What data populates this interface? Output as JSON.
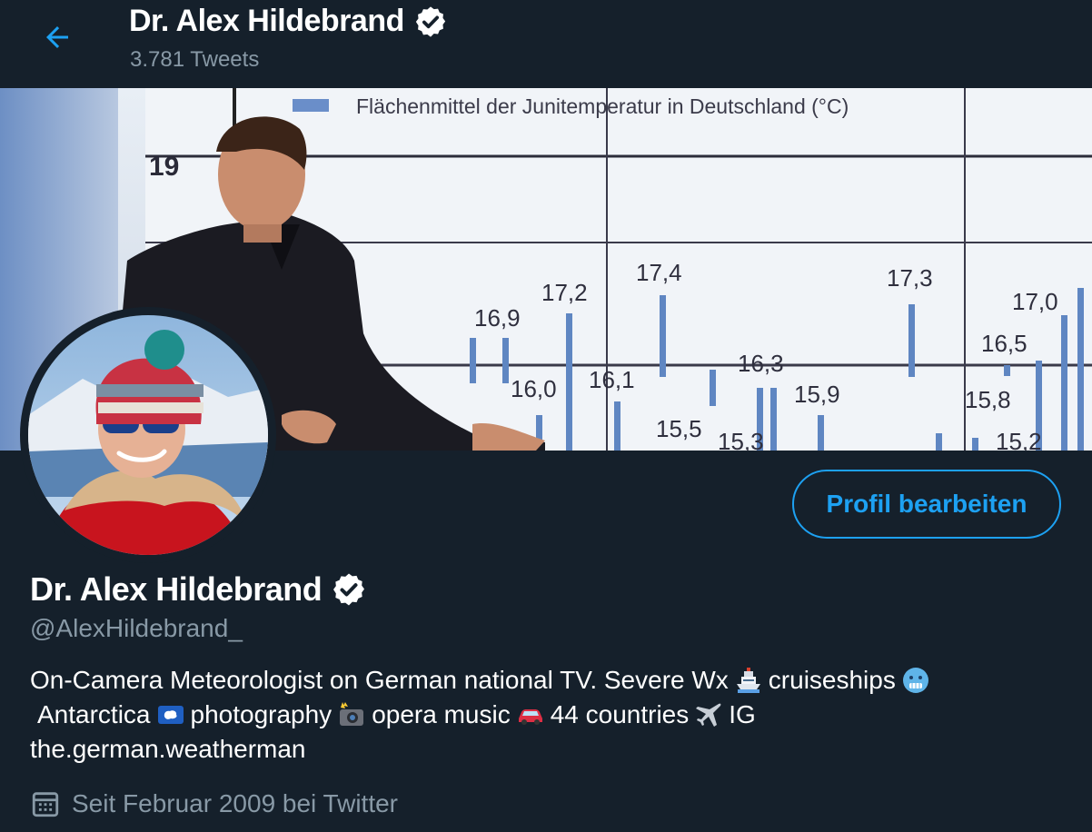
{
  "header": {
    "name": "Dr. Alex Hildebrand",
    "tweet_count": "3.781 Tweets"
  },
  "banner": {
    "chart_title": "Flächenmittel der Junitemperatur in Deutschland (°C)",
    "axis_labels": [
      "19"
    ],
    "value_labels": [
      "17,2",
      "16,9",
      "17,4",
      "16,0",
      "16,1",
      "15,5",
      "16,3",
      "15,9",
      "17,3",
      "17,0",
      "16,5",
      "15,8",
      "15,3",
      "15,2"
    ]
  },
  "profile": {
    "name": "Dr. Alex Hildebrand",
    "handle": "@AlexHildebrand_",
    "edit_button": "Profil bearbeiten",
    "bio_line1_a": "On-Camera Meteorologist on German national TV. Severe Wx ",
    "bio_line1_b": " cruiseships ",
    "bio_line2_a": "Antarctica ",
    "bio_line2_b": " photography ",
    "bio_line2_c": " opera music ",
    "bio_line2_d": "44 countries",
    "bio_line2_e": " IG",
    "bio_line3": "the.german.weatherman",
    "joined": "Seit Februar 2009 bei Twitter"
  },
  "icons": {
    "back": "arrow-left-icon",
    "verified": "verified-badge-icon",
    "calendar": "calendar-icon",
    "ship": "ship-emoji",
    "cold_face": "cold-face-emoji",
    "antarctica_flag": "antarctica-flag-emoji",
    "camera_flash": "camera-flash-emoji",
    "car": "car-emoji",
    "airplane": "airplane-emoji"
  },
  "colors": {
    "background": "#15202b",
    "accent": "#1da1f2",
    "secondary_text": "#8899a6",
    "primary_text": "#ffffff"
  }
}
